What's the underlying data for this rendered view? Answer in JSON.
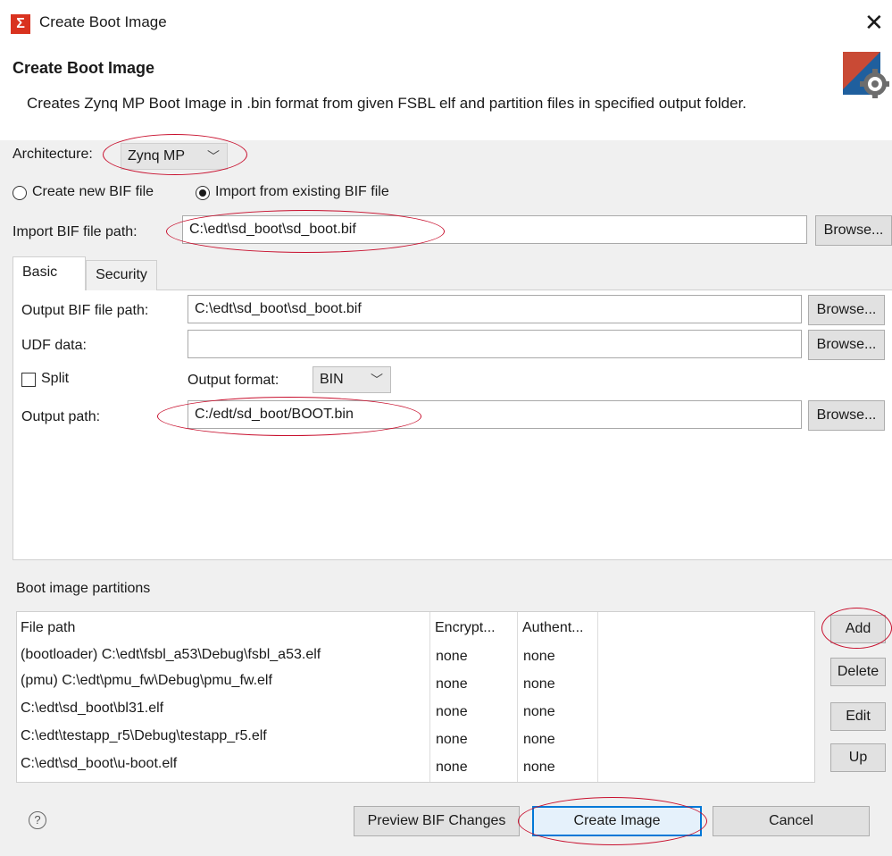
{
  "window": {
    "title": "Create Boot Image",
    "close_glyph": "✕",
    "logo_glyph": "Σ"
  },
  "header": {
    "title": "Create Boot Image",
    "description": "Creates Zynq MP Boot Image in .bin format from given FSBL elf and partition files in specified output folder.",
    "icon": "gear-icon"
  },
  "architecture": {
    "label": "Architecture:",
    "value": "Zynq MP"
  },
  "bif_mode": {
    "options": [
      "Create new BIF file",
      "Import from existing BIF file"
    ],
    "selected": "Import from existing BIF file"
  },
  "import_bif": {
    "label": "Import BIF file path:",
    "value": "C:\\edt\\sd_boot\\sd_boot.bif",
    "browse": "Browse..."
  },
  "tabs": [
    {
      "label": "Basic",
      "active": true
    },
    {
      "label": "Security",
      "active": false
    }
  ],
  "basic": {
    "output_bif": {
      "label": "Output BIF file path:",
      "value": "C:\\edt\\sd_boot\\sd_boot.bif",
      "browse": "Browse..."
    },
    "udf": {
      "label": "UDF data:",
      "value": "",
      "browse": "Browse..."
    },
    "split": {
      "label": "Split",
      "checked": false
    },
    "output_format": {
      "label": "Output format:",
      "value": "BIN"
    },
    "output_path": {
      "label": "Output path:",
      "value": "C:/edt/sd_boot/BOOT.bin",
      "browse": "Browse..."
    }
  },
  "partitions": {
    "title": "Boot image partitions",
    "columns": [
      "File path",
      "Encrypt...",
      "Authent..."
    ],
    "rows": [
      [
        "(bootloader) C:\\edt\\fsbl_a53\\Debug\\fsbl_a53.elf",
        "none",
        "none"
      ],
      [
        "(pmu) C:\\edt\\pmu_fw\\Debug\\pmu_fw.elf",
        "none",
        "none"
      ],
      [
        "C:\\edt\\sd_boot\\bl31.elf",
        "none",
        "none"
      ],
      [
        "C:\\edt\\testapp_r5\\Debug\\testapp_r5.elf",
        "none",
        "none"
      ],
      [
        "C:\\edt\\sd_boot\\u-boot.elf",
        "none",
        "none"
      ]
    ],
    "buttons": {
      "add": "Add",
      "delete": "Delete",
      "edit": "Edit",
      "up": "Up"
    }
  },
  "footer": {
    "help_glyph": "?",
    "preview": "Preview BIF Changes",
    "create": "Create Image",
    "cancel": "Cancel"
  },
  "colors": {
    "annotation": "#c8102e",
    "accent": "#0078d7",
    "logo": "#d9321f"
  }
}
